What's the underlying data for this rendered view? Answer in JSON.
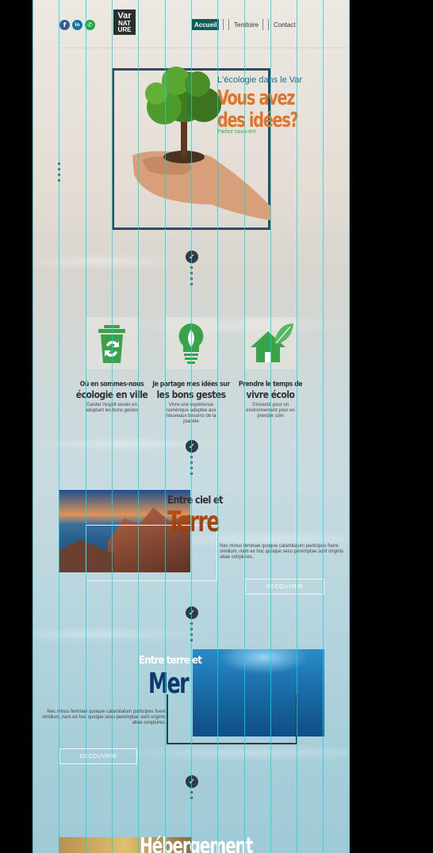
{
  "header": {
    "social": [
      {
        "name": "facebook",
        "glyph": "f",
        "color": "#3b5998"
      },
      {
        "name": "linkedin",
        "glyph": "in",
        "color": "#0e76a8"
      },
      {
        "name": "whatsapp",
        "glyph": "✆",
        "color": "#25a244"
      }
    ],
    "logo": {
      "line1": "Var",
      "line2": "NAT",
      "line3": "URE"
    },
    "nav": [
      {
        "label": "Accueil",
        "active": true
      },
      {
        "label": "Territoire",
        "active": false
      },
      {
        "label": "Contact",
        "active": false
      }
    ]
  },
  "hero": {
    "kicker": "L'écologie dans le Var",
    "title_line1": "Vous avez",
    "title_line2": "des idées?",
    "subtitle": "Parlez nous-en!"
  },
  "cards": [
    {
      "icon": "recycle-bin-icon",
      "title1": "Où en sommes-nous",
      "title2": "écologie en ville",
      "text": "Garder l'esprit serein en adoptant les bons gestes"
    },
    {
      "icon": "lightbulb-leaf-icon",
      "title1": "Je partage mes idées sur",
      "title2": "les bons gestes",
      "text": "Vivre une expérience numérique adaptée aux nouveaux besoins de la planète"
    },
    {
      "icon": "eco-house-icon",
      "title1": "Prendre le temps de",
      "title2": "vivre écolo",
      "text": "S'investir pour un environnement pour en prendre soin"
    }
  ],
  "terre": {
    "kicker": "Entre ciel et",
    "big": "Terre",
    "lorem": "Nec minus feminae quoque calamitatum participes fuere similium. nam ex hoc quoque sexu peremptae sunt originis altae conplures.",
    "button": "DECOUVRIR"
  },
  "mer": {
    "kicker": "Entre terre et",
    "big": "Mer",
    "lorem": "Nec minus feminae quoque calamitatum participes fuere similium, nam ex hoc quoque sexu peremptae sunt originis altae conplures.",
    "button": "DECOUVRIR"
  },
  "bottom": {
    "title": "Hébergement"
  },
  "colors": {
    "accent_green": "#0e5d57",
    "orange": "#e07428",
    "navy": "#34495e"
  }
}
